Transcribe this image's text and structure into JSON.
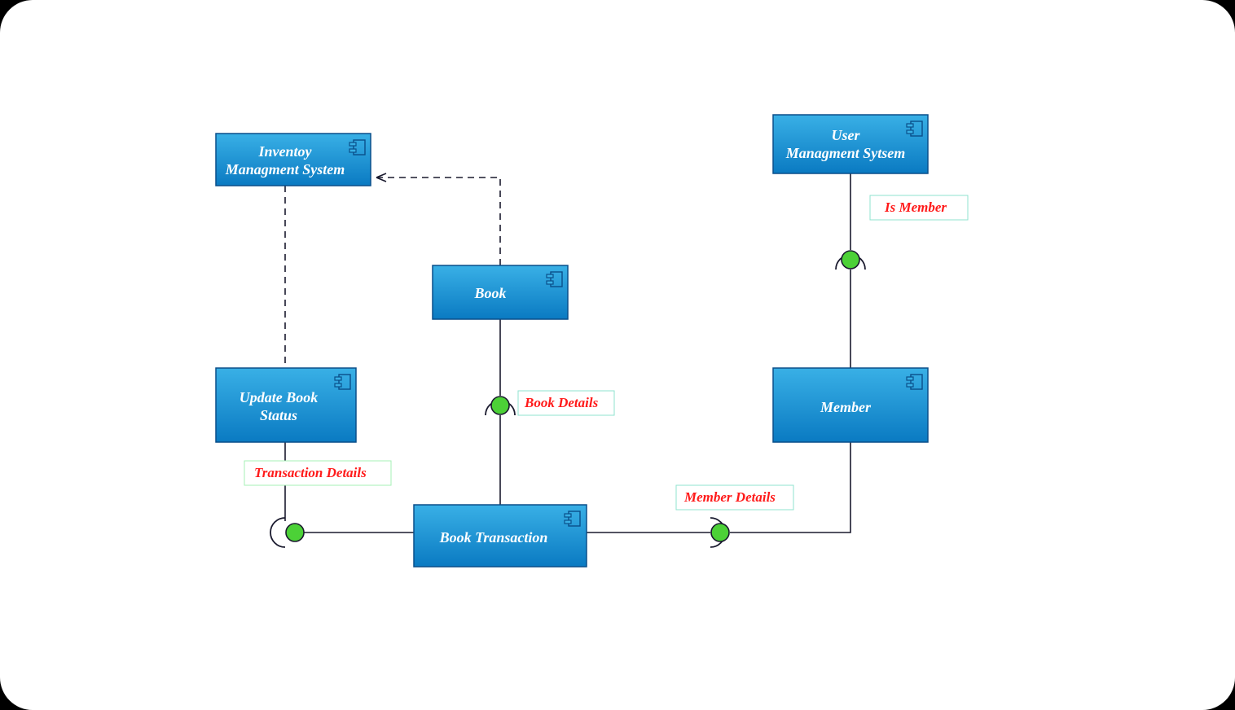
{
  "diagram": {
    "type": "uml-component",
    "components": {
      "inventory": {
        "label_line1": "Inventoy",
        "label_line2": "Managment System"
      },
      "user_mgmt": {
        "label_line1": "User",
        "label_line2": "Managment Sytsem"
      },
      "book": {
        "label_line1": "Book"
      },
      "update_book": {
        "label_line1": "Update Book",
        "label_line2": "Status"
      },
      "member": {
        "label_line1": "Member"
      },
      "book_transaction": {
        "label_line1": "Book Transaction"
      }
    },
    "interfaces": {
      "is_member": {
        "label": "Is Member"
      },
      "book_details": {
        "label": "Book Details"
      },
      "member_details": {
        "label": "Member Details"
      },
      "transaction_det": {
        "label": "Transaction Details"
      }
    },
    "colors": {
      "component_fill_top": "#2a9fd6",
      "component_fill_bot": "#0b78c2",
      "component_stroke": "#0a4f8a",
      "line": "#1a1a2e",
      "ball_fill": "#4cd137",
      "ball_stroke": "#1a1a2e",
      "label_text": "#ff1a1a",
      "label_border": "#7fe0c8",
      "label_bg": "#ffffff"
    }
  }
}
